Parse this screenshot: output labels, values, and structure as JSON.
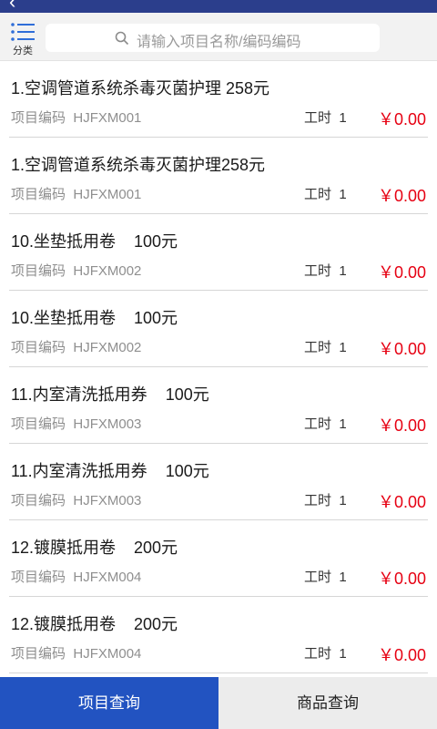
{
  "header": {
    "back_glyph": "‹",
    "category_label": "分类",
    "search_placeholder": "请输入项目名称/编码编码"
  },
  "colors": {
    "header_bg": "#2b3e8c",
    "tab_active": "#2253c1",
    "price": "#e60012"
  },
  "items": [
    {
      "title": "1.空调管道系统杀毒灭菌护理 258元",
      "code_label": "项目编码",
      "code": "HJFXM001",
      "hours_label": "工时",
      "hours": "1",
      "price": "￥0.00"
    },
    {
      "title": "1.空调管道系统杀毒灭菌护理258元",
      "code_label": "项目编码",
      "code": "HJFXM001",
      "hours_label": "工时",
      "hours": "1",
      "price": "￥0.00"
    },
    {
      "title": "10.坐垫抵用卷    100元",
      "code_label": "项目编码",
      "code": "HJFXM002",
      "hours_label": "工时",
      "hours": "1",
      "price": "￥0.00"
    },
    {
      "title": "10.坐垫抵用卷    100元",
      "code_label": "项目编码",
      "code": "HJFXM002",
      "hours_label": "工时",
      "hours": "1",
      "price": "￥0.00"
    },
    {
      "title": "11.内室清洗抵用券    100元",
      "code_label": "项目编码",
      "code": "HJFXM003",
      "hours_label": "工时",
      "hours": "1",
      "price": "￥0.00"
    },
    {
      "title": "11.内室清洗抵用券    100元",
      "code_label": "项目编码",
      "code": "HJFXM003",
      "hours_label": "工时",
      "hours": "1",
      "price": "￥0.00"
    },
    {
      "title": "12.镀膜抵用卷    200元",
      "code_label": "项目编码",
      "code": "HJFXM004",
      "hours_label": "工时",
      "hours": "1",
      "price": "￥0.00"
    },
    {
      "title": "12.镀膜抵用卷    200元",
      "code_label": "项目编码",
      "code": "HJFXM004",
      "hours_label": "工时",
      "hours": "1",
      "price": "￥0.00"
    }
  ],
  "tabs": [
    {
      "label": "项目查询",
      "active": true
    },
    {
      "label": "商品查询",
      "active": false
    }
  ]
}
